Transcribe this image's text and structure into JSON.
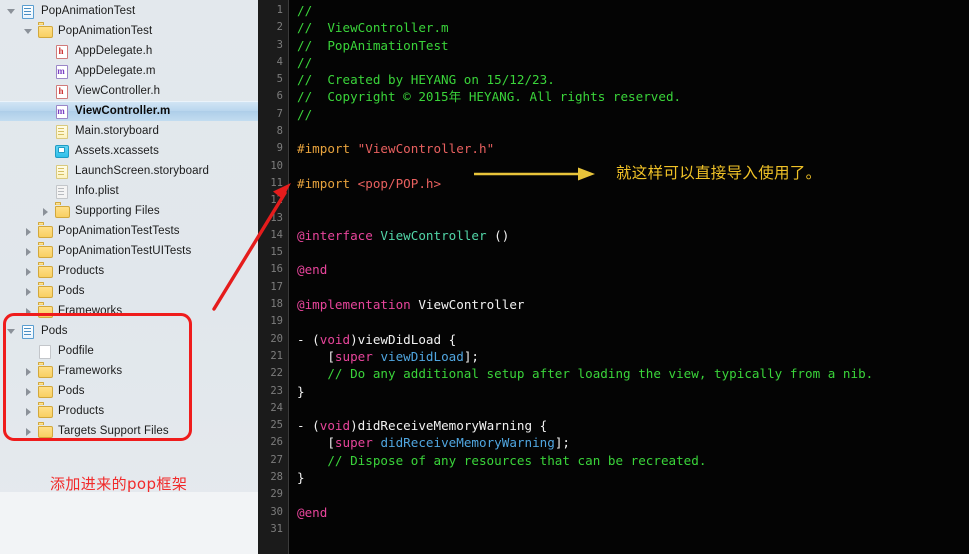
{
  "sidebar": {
    "tree": [
      {
        "label": "PopAnimationTest",
        "indent": 0,
        "twisty": "open",
        "icon": "project-icon",
        "selected": false
      },
      {
        "label": "PopAnimationTest",
        "indent": 1,
        "twisty": "open",
        "icon": "folder-icon",
        "selected": false
      },
      {
        "label": "AppDelegate.h",
        "indent": 2,
        "twisty": "none",
        "icon": "header-file-icon",
        "selected": false
      },
      {
        "label": "AppDelegate.m",
        "indent": 2,
        "twisty": "none",
        "icon": "objc-file-icon",
        "selected": false
      },
      {
        "label": "ViewController.h",
        "indent": 2,
        "twisty": "none",
        "icon": "header-file-icon",
        "selected": false
      },
      {
        "label": "ViewController.m",
        "indent": 2,
        "twisty": "none",
        "icon": "objc-file-icon",
        "selected": true
      },
      {
        "label": "Main.storyboard",
        "indent": 2,
        "twisty": "none",
        "icon": "storyboard-file-icon",
        "selected": false
      },
      {
        "label": "Assets.xcassets",
        "indent": 2,
        "twisty": "none",
        "icon": "assets-catalog-icon",
        "selected": false
      },
      {
        "label": "LaunchScreen.storyboard",
        "indent": 2,
        "twisty": "none",
        "icon": "storyboard-file-icon",
        "selected": false
      },
      {
        "label": "Info.plist",
        "indent": 2,
        "twisty": "none",
        "icon": "plist-file-icon",
        "selected": false
      },
      {
        "label": "Supporting Files",
        "indent": 2,
        "twisty": "closed",
        "icon": "folder-icon",
        "selected": false
      },
      {
        "label": "PopAnimationTestTests",
        "indent": 1,
        "twisty": "closed",
        "icon": "folder-icon",
        "selected": false
      },
      {
        "label": "PopAnimationTestUITests",
        "indent": 1,
        "twisty": "closed",
        "icon": "folder-icon",
        "selected": false
      },
      {
        "label": "Products",
        "indent": 1,
        "twisty": "closed",
        "icon": "folder-icon",
        "selected": false
      },
      {
        "label": "Pods",
        "indent": 1,
        "twisty": "closed",
        "icon": "folder-icon",
        "selected": false
      },
      {
        "label": "Frameworks",
        "indent": 1,
        "twisty": "closed",
        "icon": "folder-icon",
        "selected": false
      },
      {
        "label": "Pods",
        "indent": 0,
        "twisty": "open",
        "icon": "project-icon",
        "selected": false
      },
      {
        "label": "Podfile",
        "indent": 1,
        "twisty": "none",
        "icon": "plain-file-icon",
        "selected": false
      },
      {
        "label": "Frameworks",
        "indent": 1,
        "twisty": "closed",
        "icon": "folder-icon",
        "selected": false
      },
      {
        "label": "Pods",
        "indent": 1,
        "twisty": "closed",
        "icon": "folder-icon",
        "selected": false
      },
      {
        "label": "Products",
        "indent": 1,
        "twisty": "closed",
        "icon": "folder-icon",
        "selected": false
      },
      {
        "label": "Targets Support Files",
        "indent": 1,
        "twisty": "closed",
        "icon": "folder-icon",
        "selected": false
      }
    ],
    "caption": "添加进来的pop框架",
    "caption_color": "#f12a2a",
    "highlight_box_color": "#ef1c1c"
  },
  "editor": {
    "note": "就这样可以直接导入使用了。",
    "note_color": "#f0c227",
    "arrow_color": "#e8c43a",
    "red_arrow_color": "#e51c1c",
    "line_numbers": [
      1,
      2,
      3,
      4,
      5,
      6,
      7,
      8,
      9,
      10,
      11,
      12,
      13,
      14,
      15,
      16,
      17,
      18,
      19,
      20,
      21,
      22,
      23,
      24,
      25,
      26,
      27,
      28,
      29,
      30,
      31
    ],
    "lines": [
      [
        {
          "t": "//",
          "c": "cmt"
        }
      ],
      [
        {
          "t": "//  ViewController.m",
          "c": "cmt"
        }
      ],
      [
        {
          "t": "//  PopAnimationTest",
          "c": "cmt"
        }
      ],
      [
        {
          "t": "//",
          "c": "cmt"
        }
      ],
      [
        {
          "t": "//  Created by HEYANG on 15/12/23.",
          "c": "cmt"
        }
      ],
      [
        {
          "t": "//  Copyright © 2015年 HEYANG. All rights reserved.",
          "c": "cmt"
        }
      ],
      [
        {
          "t": "//",
          "c": "cmt"
        }
      ],
      [],
      [
        {
          "t": "#import ",
          "c": "pre"
        },
        {
          "t": "\"ViewController.h\"",
          "c": "str"
        }
      ],
      [],
      [
        {
          "t": "#import ",
          "c": "pre"
        },
        {
          "t": "<pop/POP.h>",
          "c": "str"
        }
      ],
      [],
      [],
      [
        {
          "t": "@interface ",
          "c": "kw"
        },
        {
          "t": "ViewController",
          "c": "type"
        },
        {
          "t": " ()",
          "c": "plain"
        }
      ],
      [],
      [
        {
          "t": "@end",
          "c": "kw"
        }
      ],
      [],
      [
        {
          "t": "@implementation ",
          "c": "kw"
        },
        {
          "t": "ViewController",
          "c": "plain"
        }
      ],
      [],
      [
        {
          "t": "- (",
          "c": "plain"
        },
        {
          "t": "void",
          "c": "kw"
        },
        {
          "t": ")viewDidLoad {",
          "c": "plain"
        }
      ],
      [
        {
          "t": "    [",
          "c": "plain"
        },
        {
          "t": "super",
          "c": "kw"
        },
        {
          "t": " ",
          "c": "plain"
        },
        {
          "t": "viewDidLoad",
          "c": "msg"
        },
        {
          "t": "];",
          "c": "plain"
        }
      ],
      [
        {
          "t": "    // Do any additional setup after loading the view, typically from a nib.",
          "c": "cmt"
        }
      ],
      [
        {
          "t": "}",
          "c": "plain"
        }
      ],
      [],
      [
        {
          "t": "- (",
          "c": "plain"
        },
        {
          "t": "void",
          "c": "kw"
        },
        {
          "t": ")didReceiveMemoryWarning {",
          "c": "plain"
        }
      ],
      [
        {
          "t": "    [",
          "c": "plain"
        },
        {
          "t": "super",
          "c": "kw"
        },
        {
          "t": " ",
          "c": "plain"
        },
        {
          "t": "didReceiveMemoryWarning",
          "c": "msg"
        },
        {
          "t": "];",
          "c": "plain"
        }
      ],
      [
        {
          "t": "    // Dispose of any resources that can be recreated.",
          "c": "cmt"
        }
      ],
      [
        {
          "t": "}",
          "c": "plain"
        }
      ],
      [],
      [
        {
          "t": "@end",
          "c": "kw"
        }
      ],
      []
    ]
  }
}
